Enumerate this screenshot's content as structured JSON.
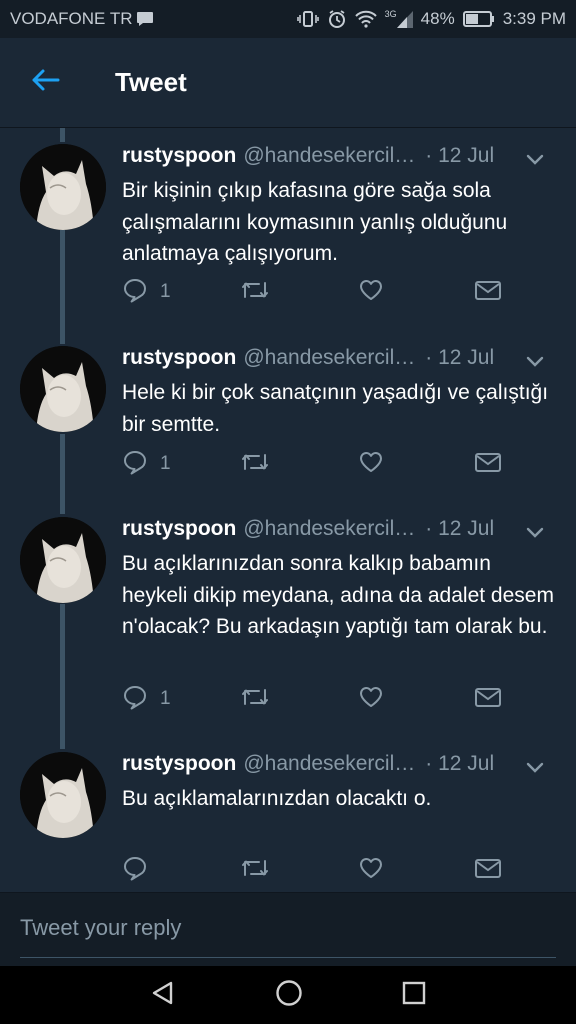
{
  "status_bar": {
    "carrier": "VODAFONE TR",
    "network": "3G",
    "battery": "48%",
    "time": "3:39 PM"
  },
  "header": {
    "title": "Tweet"
  },
  "tweets": [
    {
      "name": "rustyspoon",
      "handle": "@handesekercil…",
      "time": "· 12 Jul",
      "text": "Bir kişinin çıkıp kafasına göre sağa sola çalışmalarını koymasının yanlış olduğunu anlatmaya çalışıyorum.",
      "reply_count": "1"
    },
    {
      "name": "rustyspoon",
      "handle": "@handesekercil…",
      "time": "· 12 Jul",
      "text": "Hele ki bir çok sanatçının yaşadığı ve çalıştığı bir semtte.",
      "reply_count": "1"
    },
    {
      "name": "rustyspoon",
      "handle": "@handesekercil…",
      "time": "· 12 Jul",
      "text": "Bu açıklarınızdan sonra kalkıp babamın heykeli dikip meydana, adına da adalet desem n'olacak? Bu arkadaşın yaptığı tam olarak bu.",
      "reply_count": "1"
    },
    {
      "name": "rustyspoon",
      "handle": "@handesekercil…",
      "time": "· 12 Jul",
      "text": "Bu açıklamalarınızdan olacaktı o.",
      "reply_count": ""
    }
  ],
  "reply": {
    "placeholder": "Tweet your reply"
  },
  "colors": {
    "accent": "#1da1f2",
    "background": "#1b2836",
    "muted": "#8899a6"
  },
  "icons": [
    "back-arrow-icon",
    "reply-icon",
    "retweet-icon",
    "like-icon",
    "message-icon",
    "chevron-down-icon",
    "back-nav-icon",
    "home-nav-icon",
    "recents-nav-icon"
  ]
}
